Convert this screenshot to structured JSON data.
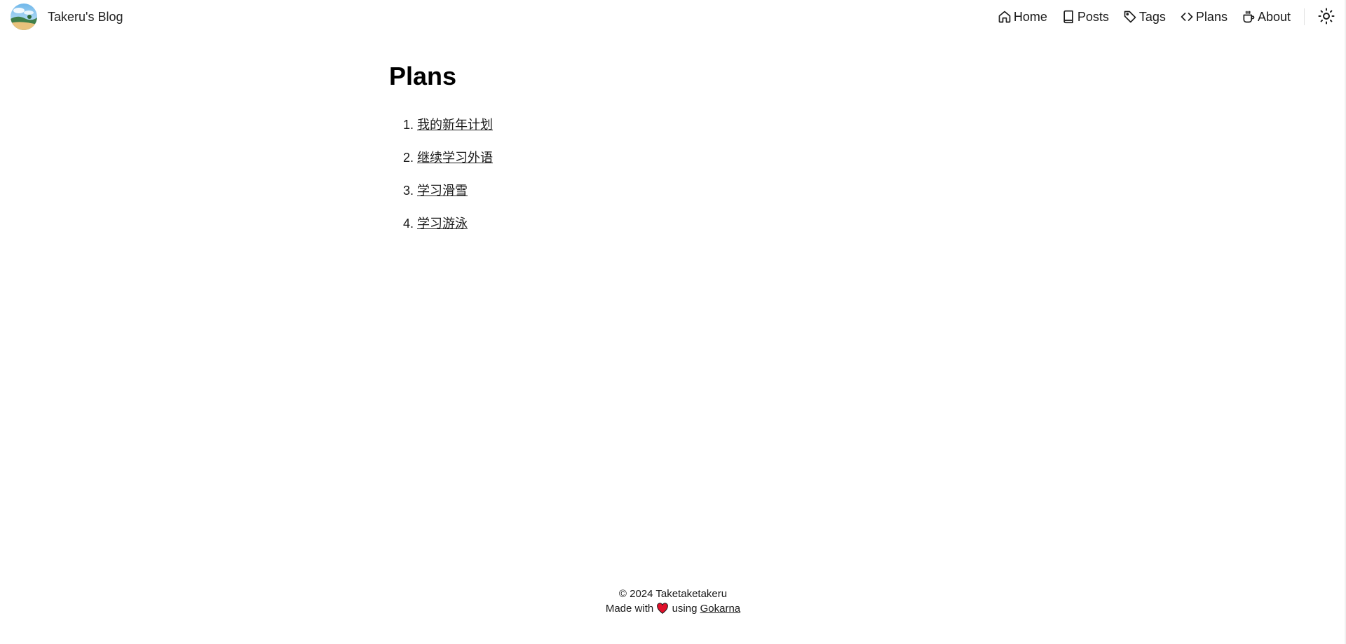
{
  "header": {
    "brand_name": "Takeru's Blog",
    "nav": [
      {
        "label": "Home",
        "icon": "home-icon"
      },
      {
        "label": "Posts",
        "icon": "book-icon"
      },
      {
        "label": "Tags",
        "icon": "tag-icon"
      },
      {
        "label": "Plans",
        "icon": "code-icon"
      },
      {
        "label": "About",
        "icon": "coffee-icon"
      }
    ],
    "theme_toggle_icon": "sun-icon"
  },
  "main": {
    "title": "Plans",
    "items": [
      "我的新年计划",
      "继续学习外语",
      "学习滑雪",
      "学习游泳"
    ]
  },
  "footer": {
    "copyright": "© 2024 Taketaketakeru",
    "made_with": "Made with",
    "using": "using",
    "link_label": "Gokarna",
    "heart_color": "#e0102a"
  }
}
